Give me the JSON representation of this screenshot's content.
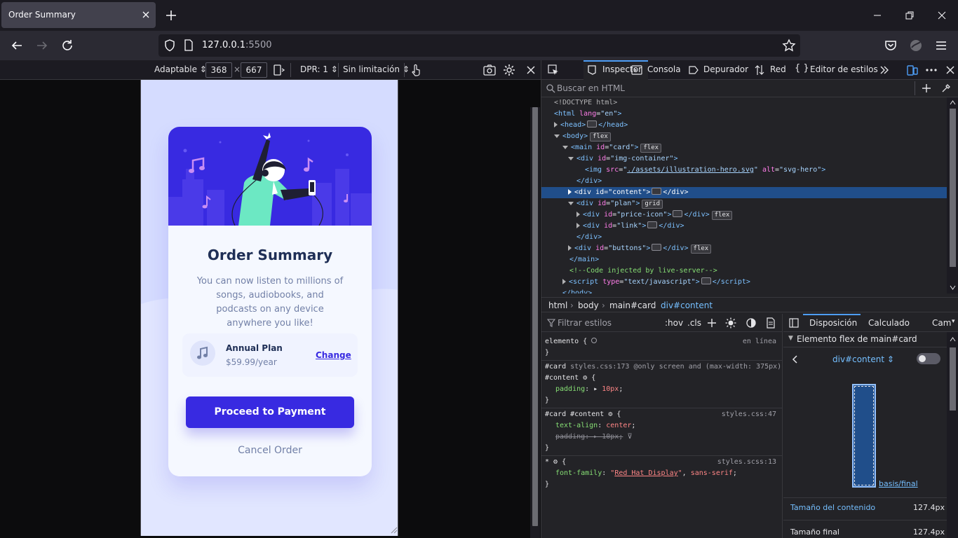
{
  "browser": {
    "tab_title": "Order Summary",
    "url_host": "127.0.0.1",
    "url_port": ":5500"
  },
  "rdm": {
    "device": "Adaptable ⇕",
    "width": "368",
    "times": "×",
    "height": "667",
    "dpr": "DPR: 1 ⇕",
    "throttle": "Sin limitación ⇕"
  },
  "page": {
    "title": "Order Summary",
    "description": "You can now listen to millions of songs, audiobooks, and podcasts on any device anywhere you like!",
    "plan_name": "Annual Plan",
    "plan_price": "$59.99/year",
    "change_label": "Change",
    "pay_label": "Proceed to Payment",
    "cancel_label": "Cancel Order"
  },
  "devtools": {
    "tabs": {
      "inspector": "Inspector",
      "console": "Consola",
      "debugger": "Depurador",
      "network": "Red",
      "style_editor": "Editor de estilos"
    },
    "search_placeholder": "Buscar en HTML",
    "breadcrumbs": [
      "html",
      "body",
      "main#card",
      "div#content"
    ],
    "rules_filter": "Filtrar estilos",
    "hov": ":hov",
    "cls": ".cls",
    "layout_tabs": [
      "Disposición",
      "Calculado",
      "Cambi"
    ],
    "flex_section": "Elemento flex de main#card",
    "flex_selector": "div#content ⇕",
    "basis_label": "basis/final",
    "content_size_label": "Tamaño del contenido",
    "content_size_value": "127.4px",
    "final_size_label": "Tamaño final",
    "final_size_value": "127.4px"
  },
  "colors": {
    "accent": "#382ae1",
    "page_bg": "#e1e6ff",
    "title": "#1f2f56",
    "muted": "#7280a7",
    "devtools_select": "#204e8a"
  }
}
